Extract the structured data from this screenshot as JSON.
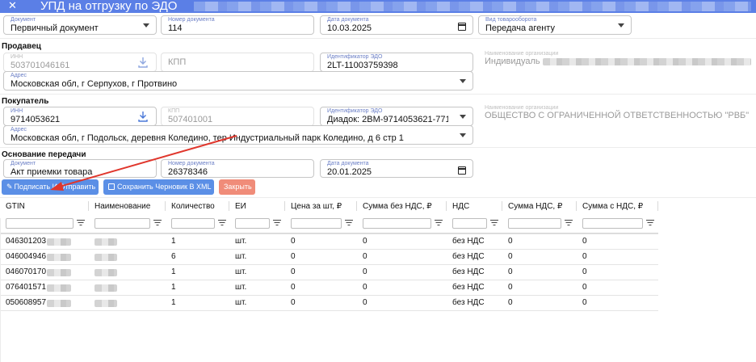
{
  "window": {
    "title": "УПД на отгрузку по ЭДО",
    "close_glyph": "✕"
  },
  "header": {
    "document": {
      "label": "Документ",
      "value": "Первичный документ"
    },
    "doc_number": {
      "label": "Номер документа",
      "value": "114"
    },
    "doc_date": {
      "label": "Дата документа",
      "value": "10.03.2025"
    },
    "trade_type": {
      "label": "Вид товарооборота",
      "value": "Передача агенту"
    }
  },
  "seller": {
    "section": "Продавец",
    "inn": {
      "label": "ИНН",
      "value": "503701046161"
    },
    "kpp": {
      "placeholder": "КПП"
    },
    "edo_id": {
      "label": "Идентификатор ЭДО",
      "value": "2LT-11003759398"
    },
    "org_name": {
      "label": "Наименование организации",
      "value": "Индивидуаль"
    },
    "address": {
      "label": "Адрес",
      "value": "Московская обл, г Серпухов, г Протвино"
    }
  },
  "buyer": {
    "section": "Покупатель",
    "inn": {
      "label": "ИНН",
      "value": "9714053621"
    },
    "kpp": {
      "label": "КПП",
      "value": "507401001"
    },
    "edo_id": {
      "label": "Идентификатор ЭДО",
      "value": "Диадок: 2BM-9714053621-771..."
    },
    "org_name": {
      "label": "Наименование организации",
      "value": "ОБЩЕСТВО С ОГРАНИЧЕННОЙ ОТВЕТСТВЕННОСТЬЮ \"РВБ\""
    },
    "address": {
      "label": "Адрес",
      "value": "Московская обл, г Подольск, деревня Коледино, тер Индустриальный парк Коледино, д 6 стр 1"
    }
  },
  "basis": {
    "section": "Основание передачи",
    "document": {
      "label": "Документ",
      "value": "Акт приемки товара"
    },
    "doc_number": {
      "label": "Номер документа",
      "value": "26378346"
    },
    "doc_date": {
      "label": "Дата документа",
      "value": "20.01.2025"
    }
  },
  "actions": {
    "sign_send": "Подписать И Отправить",
    "save_xml": "Сохранить Черновик В XML",
    "close": "Закрыть"
  },
  "table": {
    "columns": [
      "GTIN",
      "Наименование",
      "Количество",
      "ЕИ",
      "Цена за шт, ₽",
      "Сумма без НДС, ₽",
      "НДС",
      "Сумма НДС, ₽",
      "Сумма с НДС, ₽"
    ],
    "rows": [
      [
        "046301203",
        "",
        "1",
        "шт.",
        "0",
        "0",
        "без НДС",
        "0",
        "0"
      ],
      [
        "046004946",
        "",
        "6",
        "шт.",
        "0",
        "0",
        "без НДС",
        "0",
        "0"
      ],
      [
        "046070170",
        "",
        "1",
        "шт.",
        "0",
        "0",
        "без НДС",
        "0",
        "0"
      ],
      [
        "076401571",
        "",
        "1",
        "шт.",
        "0",
        "0",
        "без НДС",
        "0",
        "0"
      ],
      [
        "050608957",
        "",
        "1",
        "шт.",
        "0",
        "0",
        "без НДС",
        "0",
        "0"
      ]
    ]
  },
  "colors": {
    "accent": "#5b8fe6",
    "titlebar": "#5b7fe6",
    "danger": "#f08c79",
    "annotation_arrow": "#e0362c"
  }
}
